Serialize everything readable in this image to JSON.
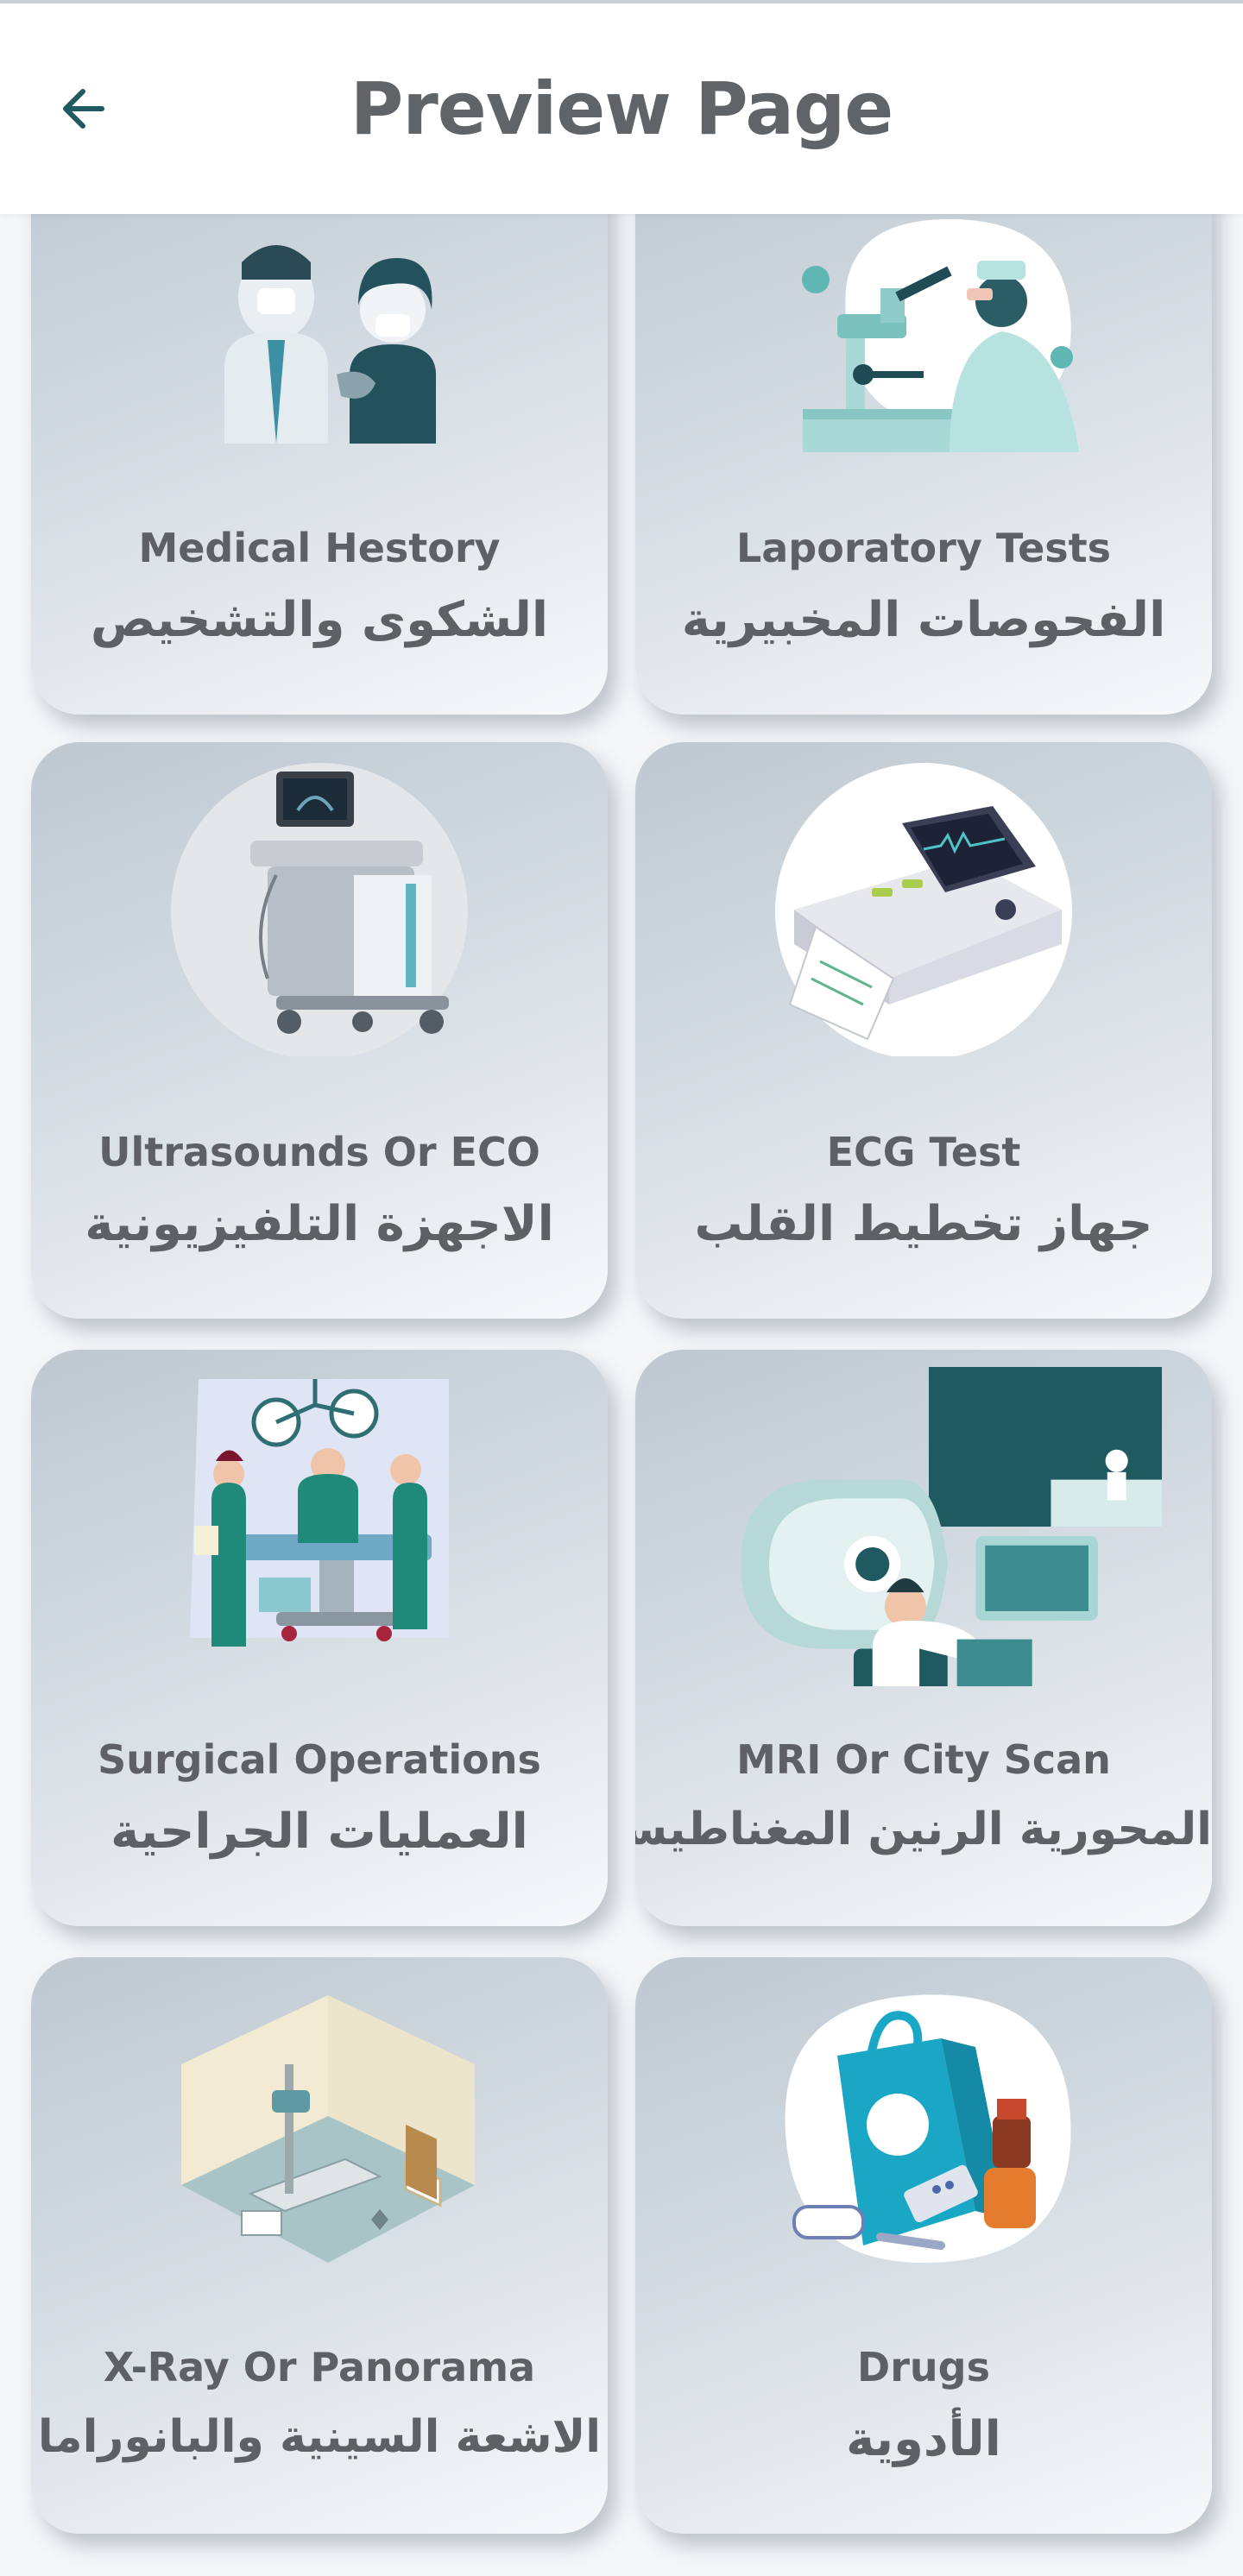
{
  "header": {
    "title": "Preview Page",
    "back_icon": "arrow-left-icon"
  },
  "colors": {
    "teal_dark": "#1f5a60",
    "teal": "#2b8f92",
    "teal_light": "#a8d9d6",
    "text": "#5d6166"
  },
  "cards": [
    {
      "en": "Medical Hestory",
      "ar": "الشكوى والتشخيص",
      "icon": "doctor-patient-illustration"
    },
    {
      "en": "Laporatory Tests",
      "ar": "الفحوصات المخبيرية",
      "icon": "lab-microscope-illustration"
    },
    {
      "en": "Ultrasounds Or ECO",
      "ar": "الاجهزة التلفيزيونية",
      "icon": "ultrasound-machine-illustration"
    },
    {
      "en": "ECG Test",
      "ar": "جهاز تخطيط القلب",
      "icon": "ecg-machine-illustration"
    },
    {
      "en": "Surgical Operations",
      "ar": "العمليات الجراحية",
      "icon": "surgery-team-illustration"
    },
    {
      "en": "MRI Or City Scan",
      "ar": "المحورية الرنين المغناطيسي",
      "icon": "mri-scanner-illustration"
    },
    {
      "en": "X-Ray Or Panorama",
      "ar": "الاشعة السينية والبانوراما",
      "icon": "xray-room-illustration"
    },
    {
      "en": "Drugs",
      "ar": "الأدوية",
      "icon": "pharmacy-bag-illustration"
    }
  ]
}
